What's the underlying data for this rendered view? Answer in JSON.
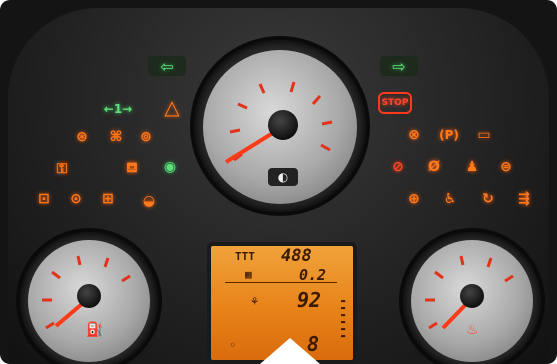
{
  "dashboard": {
    "lcd": {
      "odometer": "488",
      "trip": "0.2",
      "temperature": "92",
      "gear": "8"
    },
    "warning_lights": {
      "stop_label": "STOP",
      "parking_label": "(P)",
      "lane_assist_label": "←1→"
    }
  }
}
